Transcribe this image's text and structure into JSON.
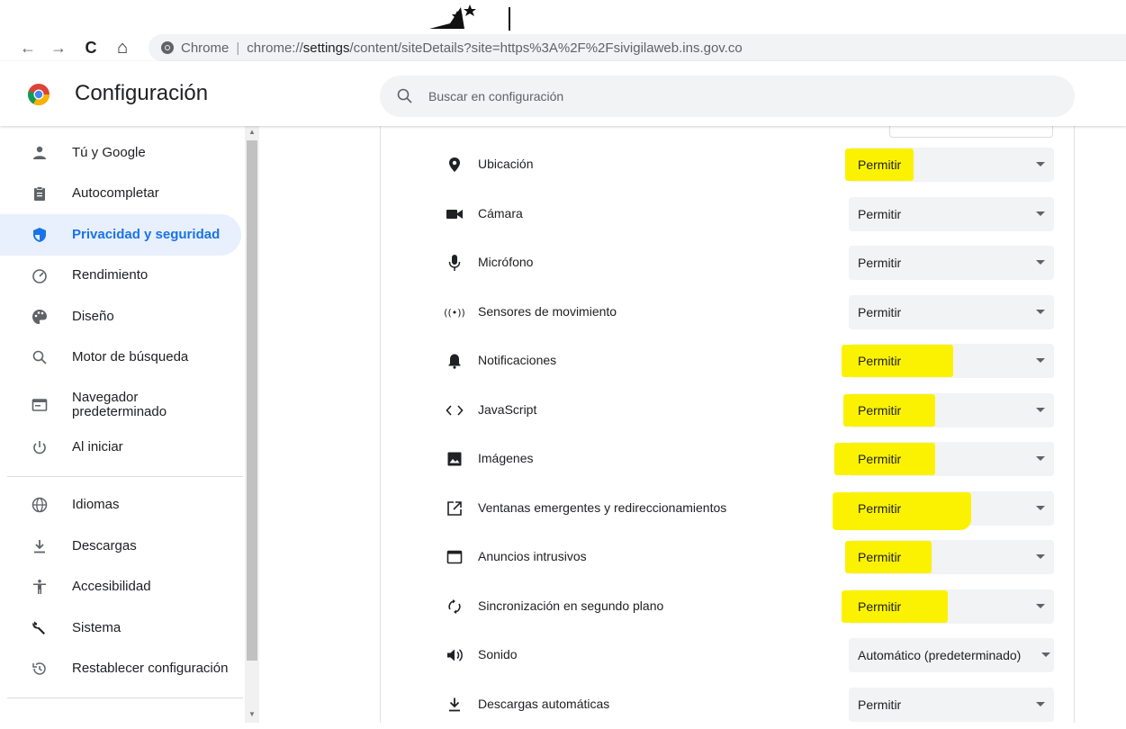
{
  "browser": {
    "back": "←",
    "forward": "→",
    "reload": "C",
    "home": "⌂",
    "site_label": "Chrome",
    "separator": "|",
    "url_prefix": "chrome://",
    "url_host": "settings",
    "url_path": "/content/siteDetails?site=https%3A%2F%2Fsivigilaweb.ins.gov.co"
  },
  "header": {
    "title": "Configuración",
    "search_placeholder": "Buscar en configuración"
  },
  "sidebar": {
    "items": [
      {
        "label": "Tú y Google",
        "icon": "person-icon"
      },
      {
        "label": "Autocompletar",
        "icon": "clipboard-icon"
      },
      {
        "label": "Privacidad y seguridad",
        "icon": "shield-icon"
      },
      {
        "label": "Rendimiento",
        "icon": "speedometer-icon"
      },
      {
        "label": "Diseño",
        "icon": "palette-icon"
      },
      {
        "label": "Motor de búsqueda",
        "icon": "search-icon"
      },
      {
        "label_line1": "Navegador",
        "label_line2": "predeterminado",
        "icon": "browser-icon"
      },
      {
        "label": "Al iniciar",
        "icon": "power-icon"
      },
      {
        "label": "Idiomas",
        "icon": "globe-icon"
      },
      {
        "label": "Descargas",
        "icon": "download-icon"
      },
      {
        "label": "Accesibilidad",
        "icon": "accessibility-icon"
      },
      {
        "label": "Sistema",
        "icon": "wrench-icon"
      },
      {
        "label": "Restablecer configuración",
        "icon": "restore-icon"
      }
    ]
  },
  "permissions": [
    {
      "label": "Ubicación",
      "value": "Permitir",
      "icon": "location-icon",
      "highlighted": true
    },
    {
      "label": "Cámara",
      "value": "Permitir",
      "icon": "camera-icon",
      "highlighted": false
    },
    {
      "label": "Micrófono",
      "value": "Permitir",
      "icon": "microphone-icon",
      "highlighted": false
    },
    {
      "label": "Sensores de movimiento",
      "value": "Permitir",
      "icon": "sensors-icon",
      "highlighted": false
    },
    {
      "label": "Notificaciones",
      "value": "Permitir",
      "icon": "bell-icon",
      "highlighted": true
    },
    {
      "label": "JavaScript",
      "value": "Permitir",
      "icon": "code-icon",
      "highlighted": true
    },
    {
      "label": "Imágenes",
      "value": "Permitir",
      "icon": "image-icon",
      "highlighted": true
    },
    {
      "label": "Ventanas emergentes y redireccionamientos",
      "value": "Permitir",
      "icon": "popup-icon",
      "highlighted": true
    },
    {
      "label": "Anuncios intrusivos",
      "value": "Permitir",
      "icon": "ads-icon",
      "highlighted": true
    },
    {
      "label": "Sincronización en segundo plano",
      "value": "Permitir",
      "icon": "sync-icon",
      "highlighted": true
    },
    {
      "label": "Sonido",
      "value": "Automático (predeterminado)",
      "icon": "sound-icon",
      "highlighted": false
    },
    {
      "label": "Descargas automáticas",
      "value": "Permitir",
      "icon": "download-icon",
      "highlighted": false
    }
  ],
  "colors": {
    "accent": "#1a73e8",
    "highlight": "#fbf201",
    "active_bg": "#e8f0fe"
  }
}
